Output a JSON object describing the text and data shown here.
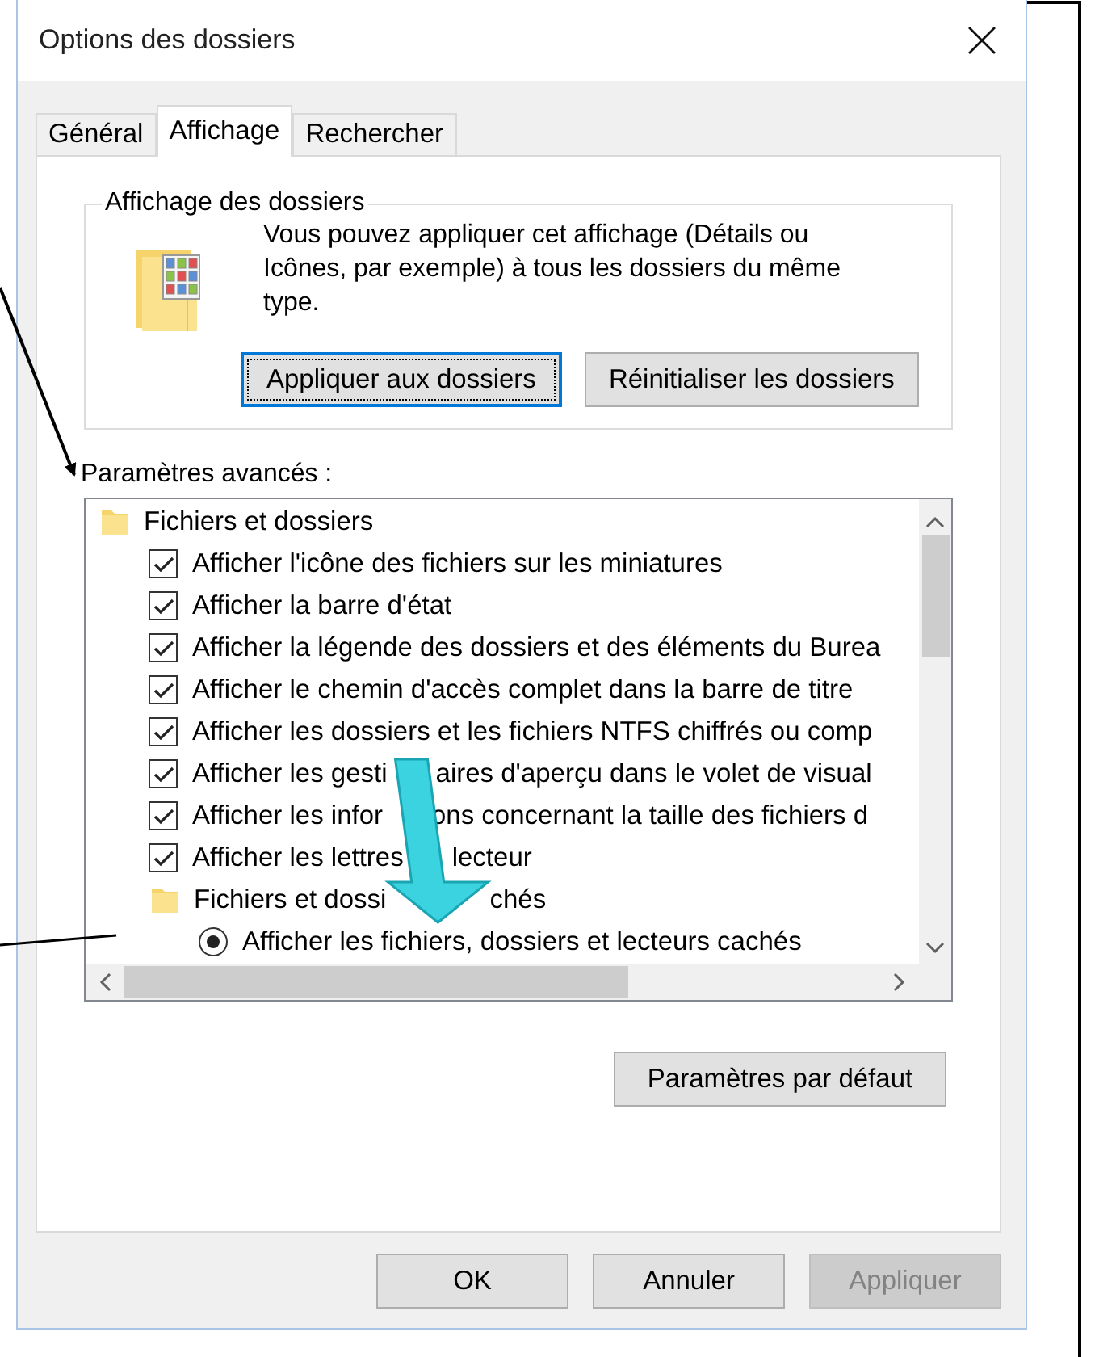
{
  "window": {
    "title": "Options des dossiers"
  },
  "tabs": [
    {
      "label": "Général",
      "selected": false
    },
    {
      "label": "Affichage",
      "selected": true
    },
    {
      "label": "Rechercher",
      "selected": false
    }
  ],
  "folder_view": {
    "title": "Affichage des dossiers",
    "description": "Vous pouvez appliquer cet affichage (Détails ou Icônes, par exemple) à tous les dossiers du même type.",
    "buttons": [
      {
        "label": "Appliquer aux dossiers",
        "focused": true
      },
      {
        "label": "Réinitialiser les dossiers",
        "focused": false
      }
    ]
  },
  "advanced": {
    "label": "Paramètres avancés :",
    "tree": [
      {
        "kind": "folder",
        "label": "Fichiers et dossiers",
        "children": [
          {
            "kind": "checkbox",
            "label": "Afficher l'icône des fichiers sur les miniatures",
            "checked": true
          },
          {
            "kind": "checkbox",
            "label": "Afficher la barre d'état",
            "checked": true
          },
          {
            "kind": "checkbox",
            "label": "Afficher la légende des dossiers et des éléments du Burea",
            "checked": true
          },
          {
            "kind": "checkbox",
            "label": "Afficher le chemin d'accès complet dans la barre de titre",
            "checked": true
          },
          {
            "kind": "checkbox",
            "label": "Afficher les dossiers et les fichiers NTFS chiffrés ou comp",
            "checked": true
          },
          {
            "kind": "checkbox",
            "label": [
              "Afficher les gesti",
              "aires d'aperçu dans le volet de visual"
            ],
            "checked": true
          },
          {
            "kind": "checkbox",
            "label": [
              "Afficher les infor",
              "ons concernant la taille des fichiers d"
            ],
            "checked": true
          },
          {
            "kind": "checkbox",
            "label": [
              "Afficher les lettres",
              "lecteur"
            ],
            "checked": true
          },
          {
            "kind": "folder",
            "label": [
              "Fichiers et dossi",
              "chés"
            ],
            "children": [
              {
                "kind": "radio",
                "label": "Afficher les fichiers, dossiers et lecteurs cachés",
                "selected": true
              }
            ]
          }
        ]
      }
    ],
    "default_button": {
      "label": "Paramètres par défaut"
    }
  },
  "dialog_buttons": [
    {
      "label": "OK",
      "disabled": false
    },
    {
      "label": "Annuler",
      "disabled": false
    },
    {
      "label": "Appliquer",
      "disabled": true
    }
  ]
}
